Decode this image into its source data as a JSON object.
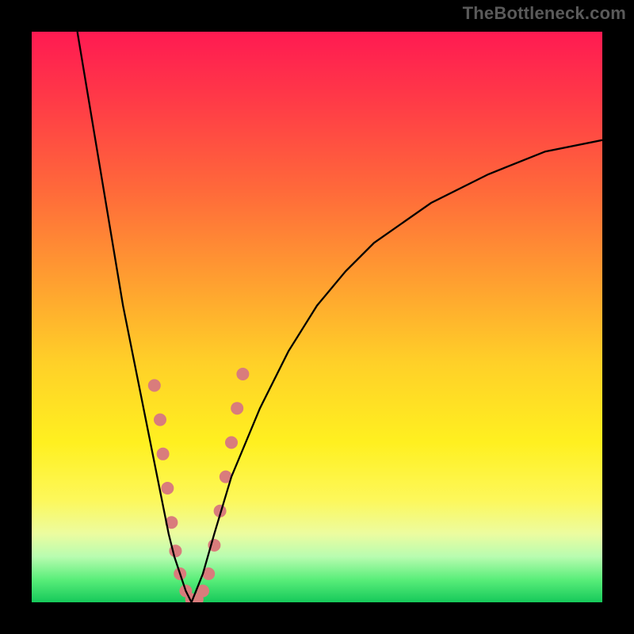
{
  "watermark": "TheBottleneck.com",
  "chart_data": {
    "type": "line",
    "title": "",
    "xlabel": "",
    "ylabel": "",
    "xlim": [
      0,
      100
    ],
    "ylim": [
      0,
      100
    ],
    "series": [
      {
        "name": "left-curve",
        "x": [
          8,
          10,
          12,
          14,
          16,
          18,
          20,
          22,
          24,
          25,
          26,
          27,
          28
        ],
        "y": [
          100,
          88,
          76,
          64,
          52,
          42,
          32,
          22,
          12,
          8,
          5,
          2,
          0
        ]
      },
      {
        "name": "right-curve",
        "x": [
          28,
          30,
          32,
          35,
          40,
          45,
          50,
          55,
          60,
          70,
          80,
          90,
          100
        ],
        "y": [
          0,
          5,
          12,
          22,
          34,
          44,
          52,
          58,
          63,
          70,
          75,
          79,
          81
        ]
      }
    ],
    "highlight_dots": {
      "name": "dots-near-minimum",
      "color": "#d97c7c",
      "points": [
        {
          "x": 21.5,
          "y": 38
        },
        {
          "x": 22.5,
          "y": 32
        },
        {
          "x": 23.0,
          "y": 26
        },
        {
          "x": 23.8,
          "y": 20
        },
        {
          "x": 24.5,
          "y": 14
        },
        {
          "x": 25.2,
          "y": 9
        },
        {
          "x": 26.0,
          "y": 5
        },
        {
          "x": 27.0,
          "y": 2
        },
        {
          "x": 28.0,
          "y": 0.5
        },
        {
          "x": 29.0,
          "y": 0.5
        },
        {
          "x": 30.0,
          "y": 2
        },
        {
          "x": 31.0,
          "y": 5
        },
        {
          "x": 32.0,
          "y": 10
        },
        {
          "x": 33.0,
          "y": 16
        },
        {
          "x": 34.0,
          "y": 22
        },
        {
          "x": 35.0,
          "y": 28
        },
        {
          "x": 36.0,
          "y": 34
        },
        {
          "x": 37.0,
          "y": 40
        }
      ]
    },
    "curve_style": {
      "stroke": "#000000",
      "width": 2.3
    },
    "dot_style": {
      "radius": 8
    }
  }
}
